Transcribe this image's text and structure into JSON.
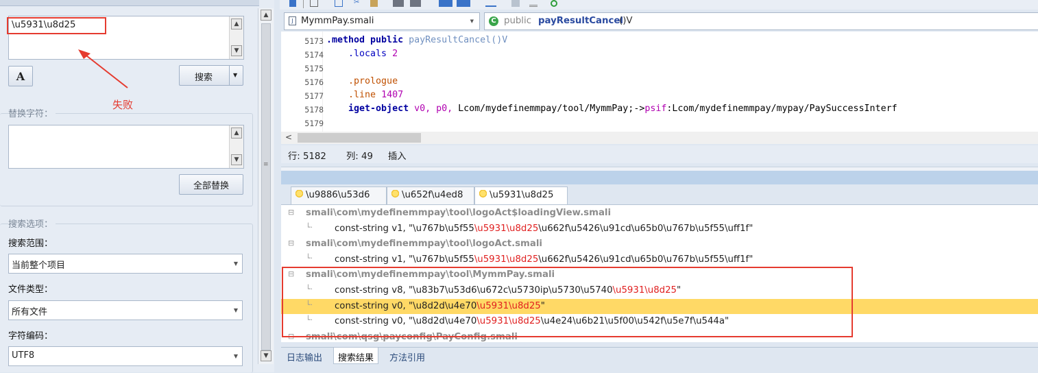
{
  "find": {
    "value": "\\u5931\\u8d25",
    "annotation": "失败",
    "search_label": "搜索"
  },
  "replace": {
    "group_label": "替换字符：",
    "replace_all_label": "全部替换"
  },
  "options": {
    "group_label": "搜索选项：",
    "scope_label": "搜索范围：",
    "scope_value": "当前整个项目",
    "type_label": "文件类型：",
    "type_value": "所有文件",
    "encoding_label": "字符编码：",
    "encoding_value": "UTF8"
  },
  "editor": {
    "file_name": "MymmPay.smali",
    "method_combo": {
      "prefix": "public",
      "name": "payResultCancel",
      "sig": " ()V"
    },
    "lines": [
      {
        "num": "5173",
        "segments": [
          {
            "t": ".method public ",
            "c": "kw"
          },
          {
            "t": "payResultCancel",
            "c": "meth"
          },
          {
            "t": "()V",
            "c": "meth"
          }
        ]
      },
      {
        "num": "5174",
        "segments": [
          {
            "t": "    .locals ",
            "c": "dir2"
          },
          {
            "t": "2",
            "c": "reg"
          }
        ]
      },
      {
        "num": "5175",
        "segments": []
      },
      {
        "num": "5176",
        "segments": [
          {
            "t": "    .prologue",
            "c": "dir"
          }
        ]
      },
      {
        "num": "5177",
        "segments": [
          {
            "t": "    .line ",
            "c": "dir"
          },
          {
            "t": "1407",
            "c": "reg"
          }
        ]
      },
      {
        "num": "5178",
        "segments": [
          {
            "t": "    iget-object ",
            "c": "kw"
          },
          {
            "t": "v0, p0, ",
            "c": "reg"
          },
          {
            "t": "Lcom/mydefinemmpay/tool/MymmPay;->",
            "c": "cls"
          },
          {
            "t": "psif",
            "c": "reg"
          },
          {
            "t": ":Lcom/mydefinemmpay/mypay/PaySuccessInterf",
            "c": "cls"
          }
        ]
      },
      {
        "num": "5179",
        "segments": []
      }
    ],
    "status": {
      "row_label": "行: 5182",
      "col_label": "列: 49",
      "mode_label": "插入"
    }
  },
  "results": {
    "tabs": [
      "\\u9886\\u53d6",
      "\\u652f\\u4ed8",
      "\\u5931\\u8d25"
    ],
    "items": [
      {
        "kind": "file",
        "text": "smali\\com\\mydefinemmpay\\tool\\logoAct$loadingView.smali"
      },
      {
        "kind": "hit",
        "pre": "const-string v1, \"\\u767b\\u5f55",
        "match": "\\u5931\\u8d25",
        "post": "\\u662f\\u5426\\u91cd\\u65b0\\u767b\\u5f55\\uff1f\""
      },
      {
        "kind": "file",
        "text": "smali\\com\\mydefinemmpay\\tool\\logoAct.smali"
      },
      {
        "kind": "hit",
        "pre": "const-string v1, \"\\u767b\\u5f55",
        "match": "\\u5931\\u8d25",
        "post": "\\u662f\\u5426\\u91cd\\u65b0\\u767b\\u5f55\\uff1f\""
      },
      {
        "kind": "file",
        "text": "smali\\com\\mydefinemmpay\\tool\\MymmPay.smali"
      },
      {
        "kind": "hit",
        "pre": "const-string v8, \"\\u83b7\\u53d6\\u672c\\u5730ip\\u5730\\u5740",
        "match": "\\u5931\\u8d25",
        "post": "\""
      },
      {
        "kind": "hit",
        "pre": "const-string v0, \"\\u8d2d\\u4e70",
        "match": "\\u5931\\u8d25",
        "post": "\"",
        "selected": true
      },
      {
        "kind": "hit",
        "pre": "const-string v0, \"\\u8d2d\\u4e70",
        "match": "\\u5931\\u8d25",
        "post": "\\u4e24\\u6b21\\u5f00\\u542f\\u5e7f\\u544a\""
      },
      {
        "kind": "file",
        "text": "smali\\com\\qsg\\payconfig\\PayConfig.smali"
      }
    ],
    "bottom_tabs": [
      "日志输出",
      "搜索结果",
      "方法引用"
    ]
  }
}
